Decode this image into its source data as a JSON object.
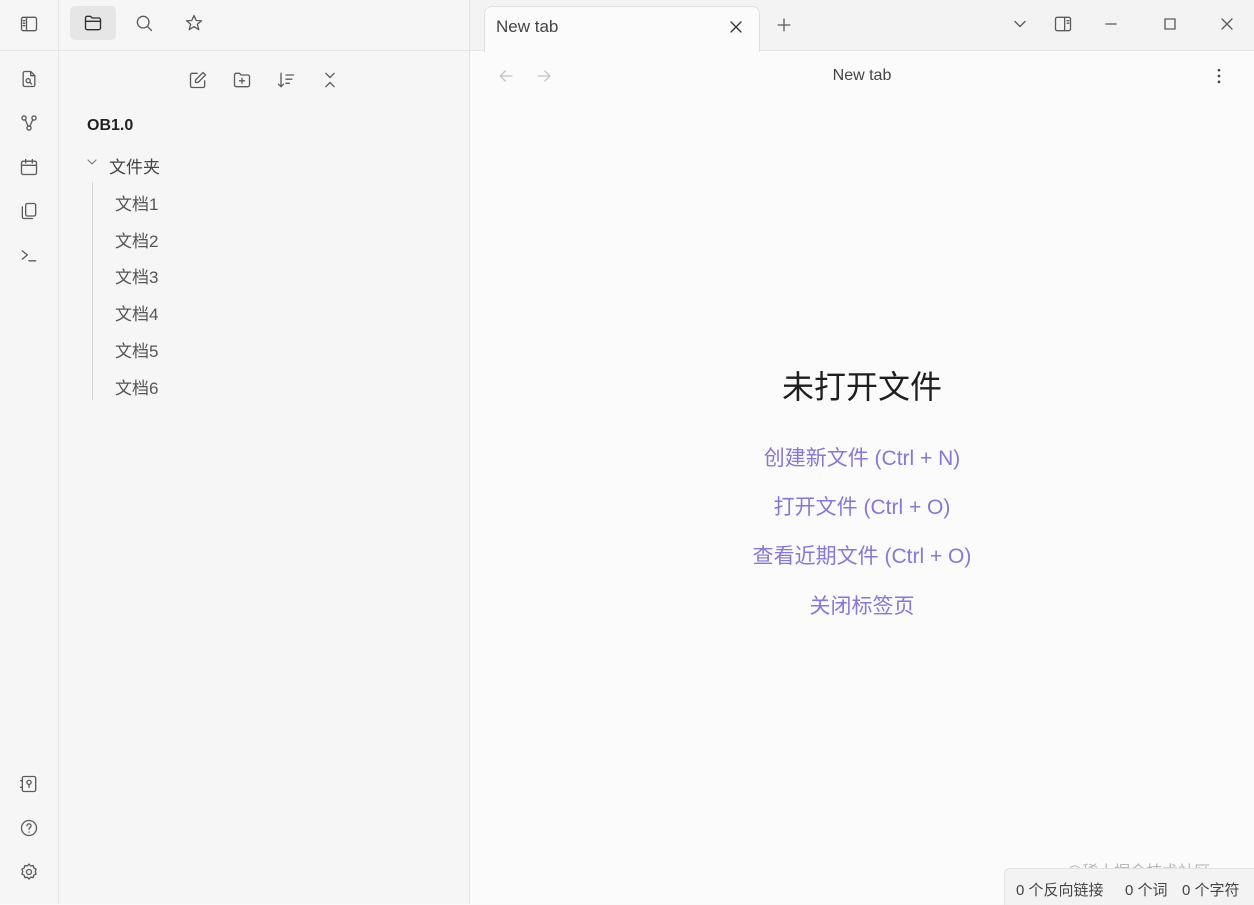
{
  "sidebar": {
    "vault_name": "OB1.0",
    "folder": "文件夹",
    "files": [
      "文档1",
      "文档2",
      "文档3",
      "文档4",
      "文档5",
      "文档6"
    ]
  },
  "tab": {
    "label": "New tab"
  },
  "view": {
    "title": "New tab"
  },
  "empty_state": {
    "title": "未打开文件",
    "actions": [
      "创建新文件 (Ctrl + N)",
      "打开文件 (Ctrl + O)",
      "查看近期文件 (Ctrl + O)",
      "关闭标签页"
    ]
  },
  "status": {
    "backlinks": "0 个反向链接",
    "words": "0 个词",
    "chars": "0 个字符"
  },
  "watermark": "@稀土掘金技术社区",
  "colors": {
    "accent": "#8a76d4",
    "ribbon_bg": "#f6f6f6",
    "main_bg": "#fbfbfc"
  },
  "icons": {
    "ribbon": [
      "open-quick-switcher-icon",
      "graph-view-icon",
      "daily-note-icon",
      "templates-icon",
      "command-palette-icon"
    ],
    "ribbon_bottom": [
      "open-vault-icon",
      "help-icon",
      "settings-icon"
    ]
  }
}
